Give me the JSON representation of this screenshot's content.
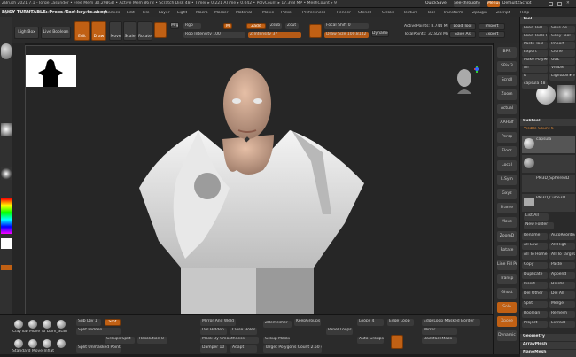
{
  "app": {
    "title": "ZBrush 2021.7.1  - Jorge Lasunder  • Free Mem 30.298GB • Active Mem 8678 • Scratch Disk 48 • Timer ▸ 0.221 ATime ▸ 0.042 • PolyCount ▸ 17.398 MP • MeshCount ▸ 9",
    "notice": "BUSY TURNTABLE: Press 'Esc' key to abort",
    "quicksave": "QuickSave",
    "see_through": "See-through 0",
    "menus_label": "Menus",
    "default_script": "DefaultZScript"
  },
  "menubar": [
    "Alpha",
    "Brush",
    "Color",
    "Document",
    "Draw",
    "Dynamics",
    "Edit",
    "File",
    "Layer",
    "Light",
    "Macro",
    "Marker",
    "Material",
    "Movie",
    "Picker",
    "Preferences",
    "Render",
    "Stencil",
    "Stroke",
    "Texture",
    "Tool",
    "Transform",
    "Zplugin",
    "Zscript",
    "Help"
  ],
  "toolbar": {
    "home": "Home Page",
    "lightbox": "LightBox",
    "live_boolean": "Live Boolean",
    "edit": "Edit",
    "draw": "Draw",
    "move": "Move",
    "scale": "Scale",
    "rotate": "Rotate",
    "mrgb": "Mrgb",
    "rgb": "Rgb",
    "m": "M",
    "zadd": "Zadd",
    "zsub": "Zsub",
    "zcut": "Zcut",
    "rgb_intensity": "Rgb Intensity 100",
    "z_intensity": "Z Intensity 37",
    "focal_shift": "Focal Shift 0",
    "draw_size": "Draw Size 100.8142",
    "dynamic": "Dynamic",
    "active_points": "ActivePoints: 8.744 Mil",
    "total_points": "TotalPoints: 32.828 Mil",
    "load_tool": "Load Tool",
    "save_as": "Save As",
    "import": "Import",
    "export": "Export"
  },
  "bottom": {
    "col1": [
      "ClayTub",
      "Move To",
      "Dam_Stan",
      "TrimDyn",
      "Standard",
      "Move",
      "Inflat",
      "Move"
    ],
    "row_a": [
      "Sub Div 1",
      "Smt",
      "Split Hidden",
      "Split Unmasked Points"
    ],
    "row_b": [
      "Groups Split",
      "Resolution 8"
    ],
    "row_c": [
      "Mirror And Weld",
      "Del Hidden",
      "Close Holes"
    ],
    "row_d": [
      "ZRemesher",
      "KeepGroups",
      "Polish",
      "Target 70"
    ],
    "row_e": [
      "Mask By Smoothness",
      "Damper 10",
      "Adapt"
    ],
    "row_f": [
      "Smooth Subdiv",
      "Group Masked",
      "Blur 2",
      "Target Polygons Count 2.50 944"
    ],
    "row_g": [
      "Loops 4",
      "Panel Loops",
      "Edge Loop",
      "Polish"
    ],
    "row_h": [
      "EdgeLoop Masked Border",
      "Mirror",
      "BackfaceMask"
    ],
    "row_i": [
      "Auto Groups",
      "Thin",
      "Inflate"
    ],
    "layers_label": "Layers",
    "divide_label": "Divide",
    "higher_label": "Higher",
    "lower_label": "Lower"
  },
  "right_shelf": [
    "BPR",
    "SPix 3",
    "Scroll",
    "Zoom",
    "Actual",
    "AAHalf",
    "Persp",
    "Floor",
    "Local",
    "L.Sym",
    "Gxyz",
    "Frame",
    "Move",
    "ZoomD",
    "Rotate",
    "Line Fill PolyF",
    "Transp",
    "Ghost",
    "Solo",
    "Xpose",
    "Dynamic"
  ],
  "tray": {
    "title": "Tool",
    "buttons": [
      "Load Tool",
      "Save As",
      "Load Tools From Project",
      "Copy Tool",
      "Paste Tool",
      "Import",
      "Export",
      "Clone",
      "Make PolyMesh3D",
      "GoZ",
      "All",
      "Visible",
      "R",
      "Lightbox ▸ Tools",
      "capsula 48"
    ],
    "subtool_label": "Subtool",
    "subtool_visible": "Visible Count 6",
    "subtools": [
      "capsula",
      "PM3D_Sphere3D",
      "PM3D_Cube3D"
    ],
    "list_all": "List All",
    "new_folder": "New Folder",
    "actions": [
      "Rename",
      "AutoReorder",
      "All Low",
      "All High",
      "All To Home",
      "All To Target",
      "Copy",
      "Paste",
      "Duplicate",
      "Append",
      "Insert",
      "Delete",
      "Del Other",
      "Del All",
      "Split",
      "Merge",
      "Boolean",
      "Remesh",
      "Project",
      "Extract"
    ],
    "geometry": "Geometry",
    "arraymesh": "ArrayMesh",
    "nanomesh": "NanoMesh"
  },
  "left": {
    "color_label": "Gradient",
    "switch": "SwitchColor",
    "alternate": "Alternate",
    "texture_off": "Texture Off",
    "matcap": "SkinShade4"
  }
}
